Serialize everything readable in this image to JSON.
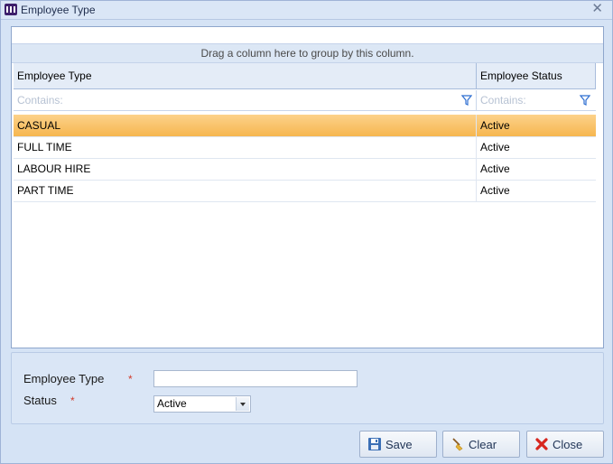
{
  "window": {
    "title": "Employee Type",
    "close_glyph": "✕"
  },
  "grid": {
    "group_panel_text": "Drag a column here to group by this column.",
    "columns": [
      {
        "label": "Employee Type"
      },
      {
        "label": "Employee Status"
      }
    ],
    "filter_placeholder": "Contains:",
    "rows": [
      {
        "type": "CASUAL",
        "status": "Active",
        "selected": true
      },
      {
        "type": "FULL TIME",
        "status": "Active",
        "selected": false
      },
      {
        "type": "LABOUR HIRE",
        "status": "Active",
        "selected": false
      },
      {
        "type": "PART TIME",
        "status": "Active",
        "selected": false
      }
    ],
    "selected_row_color": "#f8c35f"
  },
  "form": {
    "employee_type_label": "Employee Type",
    "employee_type_value": "",
    "status_label": "Status",
    "status_value": "Active",
    "required_marker": "*"
  },
  "buttons": {
    "save": "Save",
    "clear": "Clear",
    "close": "Close"
  },
  "icons": {
    "app": "app-logo-icon",
    "filter": "funnel-filter-icon",
    "save": "floppy-disk-icon",
    "clear": "broom-icon",
    "close": "red-x-icon"
  }
}
